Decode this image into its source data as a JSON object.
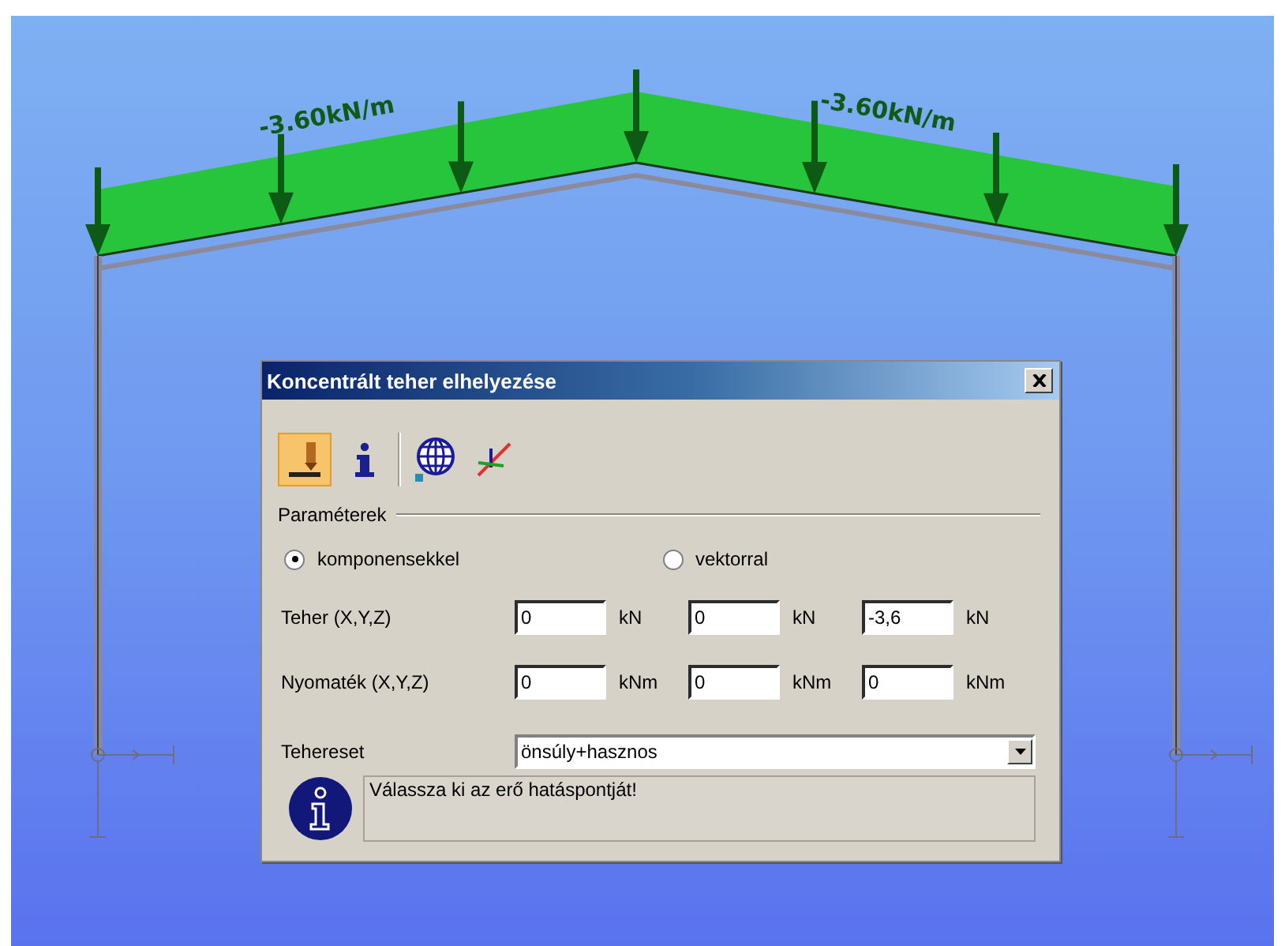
{
  "canvas": {
    "loads": [
      {
        "label": "-3.60kN/m"
      },
      {
        "label": "-3.60kN/m"
      }
    ]
  },
  "dialog": {
    "title": "Koncentrált teher elhelyezése",
    "toolbar": [
      {
        "kind": "load",
        "selected": true
      },
      {
        "kind": "info",
        "selected": false
      },
      {
        "kind": "globe",
        "selected": false
      },
      {
        "kind": "axes",
        "selected": false
      }
    ],
    "group_label": "Paraméterek",
    "radios": [
      {
        "label": "komponensekkel",
        "selected": true
      },
      {
        "label": "vektorral",
        "selected": false
      }
    ],
    "rows": [
      {
        "label": "Teher (X,Y,Z)",
        "fields": [
          {
            "value": "0",
            "unit": "kN"
          },
          {
            "value": "0",
            "unit": "kN"
          },
          {
            "value": "-3,6",
            "unit": "kN"
          }
        ]
      },
      {
        "label": "Nyomaték (X,Y,Z)",
        "fields": [
          {
            "value": "0",
            "unit": "kNm"
          },
          {
            "value": "0",
            "unit": "kNm"
          },
          {
            "value": "0",
            "unit": "kNm"
          }
        ]
      }
    ],
    "load_case": {
      "label": "Tehereset",
      "value": "önsúly+hasznos"
    },
    "message": "Válassza ki az erő hatáspontját!"
  }
}
